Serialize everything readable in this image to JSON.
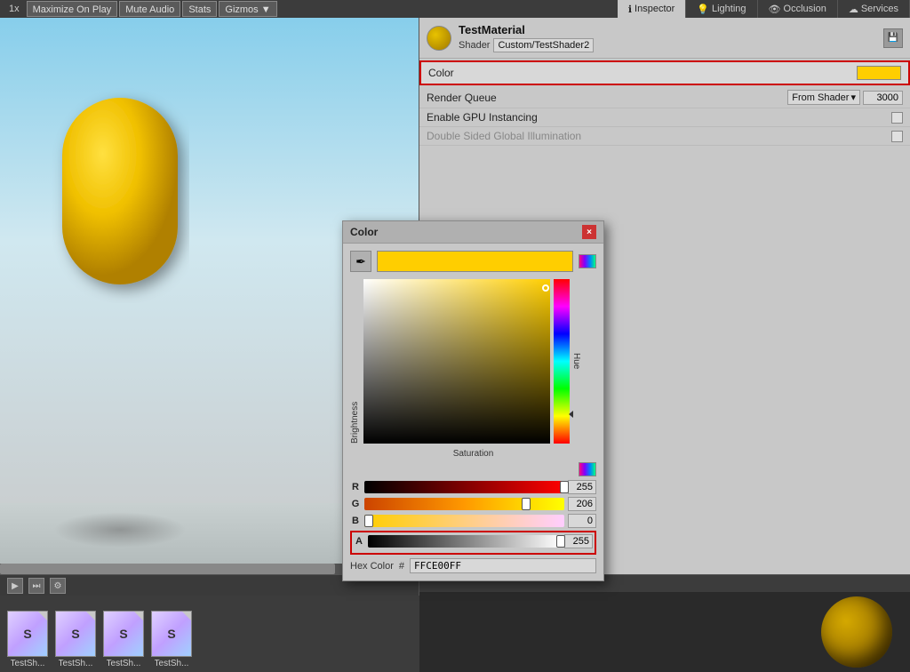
{
  "topbar": {
    "zoom": "1x",
    "buttons": [
      "Maximize On Play",
      "Mute Audio",
      "Stats",
      "Gizmos"
    ],
    "gizmos_arrow": "▼"
  },
  "inspector_tabs": [
    {
      "id": "inspector",
      "label": "Inspector",
      "icon": "ℹ",
      "active": true
    },
    {
      "id": "lighting",
      "label": "Lighting",
      "icon": "💡",
      "active": false
    },
    {
      "id": "occlusion",
      "label": "Occlusion",
      "icon": "👁",
      "active": false
    },
    {
      "id": "services",
      "label": "Services",
      "icon": "☁",
      "active": false
    }
  ],
  "material": {
    "name": "TestMaterial",
    "shader_label": "Shader",
    "shader_value": "Custom/TestShader2",
    "color_label": "Color",
    "render_queue_label": "Render Queue",
    "render_queue_value": "From Shader",
    "render_queue_number": "3000",
    "gpu_instancing_label": "Enable GPU Instancing",
    "double_sided_label": "Double Sided Global Illumination"
  },
  "color_dialog": {
    "title": "Color",
    "close_label": "×",
    "eyedropper_icon": "✒",
    "saturation_label": "Saturation",
    "brightness_label": "Brightness",
    "hue_label": "Hue",
    "channels": {
      "r": {
        "label": "R",
        "value": "255",
        "pct": 100
      },
      "g": {
        "label": "G",
        "value": "206",
        "pct": 81
      },
      "b": {
        "label": "B",
        "value": "0",
        "pct": 0
      },
      "a": {
        "label": "A",
        "value": "255",
        "pct": 100
      }
    },
    "hex_label": "Hex Color",
    "hex_hash": "#",
    "hex_value": "FFCE00FF"
  },
  "assets": [
    {
      "label": "TestSh...",
      "icon": "S"
    },
    {
      "label": "TestSh...",
      "icon": "S"
    },
    {
      "label": "TestSh...",
      "icon": "S"
    },
    {
      "label": "TestSh...",
      "icon": "S"
    }
  ]
}
